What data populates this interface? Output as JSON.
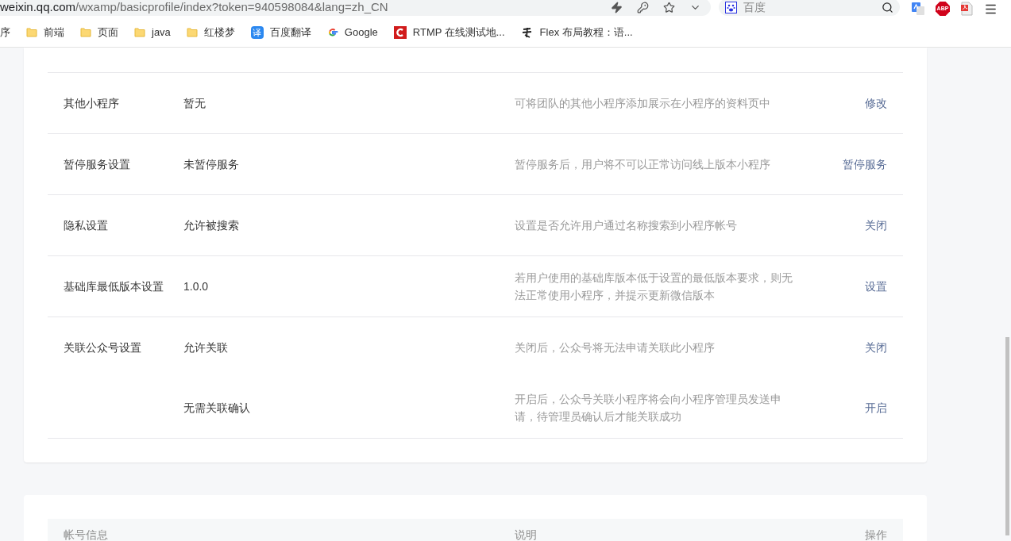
{
  "address_bar": {
    "host": "weixin.qq.com",
    "path": "/wxamp/basicprofile/index?token=940598084&lang=zh_CN"
  },
  "search_box": {
    "placeholder": "百度"
  },
  "extensions": [
    {
      "kind": "translate"
    },
    {
      "kind": "abp",
      "text": "ABP"
    },
    {
      "kind": "pdf"
    }
  ],
  "bookmarks": [
    {
      "kind": "plain",
      "label": "序"
    },
    {
      "kind": "folder",
      "label": "前端"
    },
    {
      "kind": "folder",
      "label": "页面"
    },
    {
      "kind": "folder",
      "label": "java"
    },
    {
      "kind": "folder",
      "label": "红楼梦"
    },
    {
      "kind": "translate",
      "label": "百度翻译",
      "badge": "译"
    },
    {
      "kind": "google",
      "label": "Google"
    },
    {
      "kind": "red",
      "label": "RTMP 在线测试地..."
    },
    {
      "kind": "brush",
      "label": "Flex 布局教程：语..."
    }
  ],
  "settings": [
    {
      "label": "其他小程序",
      "entries": [
        {
          "value": "暂无",
          "description": "可将团队的其他小程序添加展示在小程序的资料页中",
          "action": "修改"
        }
      ]
    },
    {
      "label": "暂停服务设置",
      "entries": [
        {
          "value": "未暂停服务",
          "description": "暂停服务后，用户将不可以正常访问线上版本小程序",
          "action": "暂停服务"
        }
      ]
    },
    {
      "label": "隐私设置",
      "entries": [
        {
          "value": "允许被搜索",
          "description": "设置是否允许用户通过名称搜索到小程序帐号",
          "action": "关闭"
        }
      ]
    },
    {
      "label": "基础库最低版本设置",
      "entries": [
        {
          "value": "1.0.0",
          "description": "若用户使用的基础库版本低于设置的最低版本要求，则无法正常使用小程序，并提示更新微信版本",
          "action": "设置"
        }
      ]
    },
    {
      "label": "关联公众号设置",
      "entries": [
        {
          "value": "允许关联",
          "description": "关闭后，公众号将无法申请关联此小程序",
          "action": "关闭"
        },
        {
          "value": "无需关联确认",
          "description": "开启后，公众号关联小程序将会向小程序管理员发送申请，待管理员确认后才能关联成功",
          "action": "开启"
        }
      ]
    }
  ],
  "account_table": {
    "columns": [
      "帐号信息",
      "说明",
      "操作"
    ]
  }
}
